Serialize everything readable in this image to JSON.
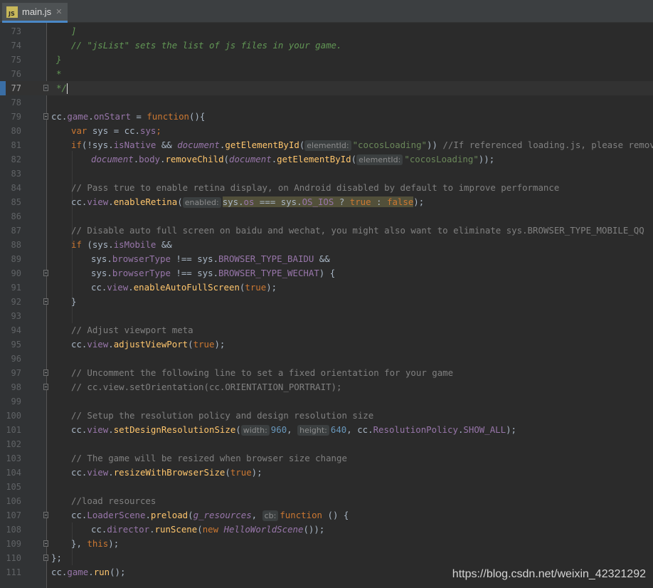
{
  "tab": {
    "label": "main.js",
    "icon": "js-file-icon",
    "badge": "JS"
  },
  "watermark": "https://blog.csdn.net/weixin_42321292",
  "colors": {
    "background": "#2b2b2b",
    "gutter": "#313335",
    "accent": "#4a88c7"
  },
  "current_line": "77",
  "line_numbers": [
    "73",
    "74",
    "75",
    "76",
    "77",
    "78",
    "79",
    "80",
    "81",
    "82",
    "83",
    "84",
    "85",
    "86",
    "87",
    "88",
    "89",
    "90",
    "91",
    "92",
    "93",
    "94",
    "95",
    "96",
    "97",
    "98",
    "99",
    "100",
    "101",
    "102",
    "103",
    "104",
    "105",
    "106",
    "107",
    "108",
    "109",
    "110",
    "111"
  ],
  "code": {
    "l73": "]",
    "l74": "// \"jsList\" sets the list of js files in your game.",
    "l75": "}",
    "l76": "*",
    "l77": "*/",
    "l79_a": "cc",
    "l79_b": ".",
    "l79_c": "game",
    "l79_d": ".",
    "l79_e": "onStart",
    "l79_f": " = ",
    "l79_g": "function",
    "l79_h": "(){",
    "l80_a": "var",
    "l80_b": " sys = ",
    "l80_c": "cc",
    "l80_d": ".",
    "l80_e": "sys",
    "l80_f": ";",
    "l81_a": "if",
    "l81_b": "(!sys.",
    "l81_c": "isNative",
    "l81_d": " && ",
    "l81_e": "document",
    "l81_f": ".",
    "l81_g": "getElementById",
    "l81_h": "(",
    "l81_hint": "elementId:",
    "l81_i": "\"cocosLoading\"",
    "l81_j": ")) ",
    "l81_k": "//If referenced loading.js, please remove it",
    "l82_a": "document",
    "l82_b": ".",
    "l82_c": "body",
    "l82_d": ".",
    "l82_e": "removeChild",
    "l82_f": "(",
    "l82_g": "document",
    "l82_h": ".",
    "l82_i": "getElementById",
    "l82_j": "(",
    "l82_hint": "elementId:",
    "l82_k": "\"cocosLoading\"",
    "l82_l": "));",
    "l84": "// Pass true to enable retina display, on Android disabled by default to improve performance",
    "l85_a": "cc",
    "l85_b": ".",
    "l85_c": "view",
    "l85_d": ".",
    "l85_e": "enableRetina",
    "l85_f": "(",
    "l85_hint": "enabled:",
    "l85_g": "sys.",
    "l85_h": "os",
    "l85_i": " === sys.",
    "l85_j": "OS_IOS",
    "l85_k": " ? ",
    "l85_l": "true",
    "l85_m": " : ",
    "l85_n": "false",
    "l85_o": ");",
    "l87": "// Disable auto full screen on baidu and wechat, you might also want to eliminate sys.BROWSER_TYPE_MOBILE_QQ",
    "l88_a": "if",
    "l88_b": " (sys.",
    "l88_c": "isMobile",
    "l88_d": " &&",
    "l89_a": "sys.",
    "l89_b": "browserType",
    "l89_c": " !== sys.",
    "l89_d": "BROWSER_TYPE_BAIDU",
    "l89_e": " &&",
    "l90_a": "sys.",
    "l90_b": "browserType",
    "l90_c": " !== sys.",
    "l90_d": "BROWSER_TYPE_WECHAT",
    "l90_e": ") {",
    "l91_a": "cc",
    "l91_b": ".",
    "l91_c": "view",
    "l91_d": ".",
    "l91_e": "enableAutoFullScreen",
    "l91_f": "(",
    "l91_g": "true",
    "l91_h": ");",
    "l92": "}",
    "l94": "// Adjust viewport meta",
    "l95_a": "cc",
    "l95_b": ".",
    "l95_c": "view",
    "l95_d": ".",
    "l95_e": "adjustViewPort",
    "l95_f": "(",
    "l95_g": "true",
    "l95_h": ");",
    "l97": "// Uncomment the following line to set a fixed orientation for your game",
    "l98": "// cc.view.setOrientation(cc.ORIENTATION_PORTRAIT);",
    "l100": "// Setup the resolution policy and design resolution size",
    "l101_a": "cc",
    "l101_b": ".",
    "l101_c": "view",
    "l101_d": ".",
    "l101_e": "setDesignResolutionSize",
    "l101_f": "(",
    "l101_hint1": "width:",
    "l101_g": "960",
    "l101_h": ", ",
    "l101_hint2": "height:",
    "l101_i": "640",
    "l101_j": ", ",
    "l101_k": "cc",
    "l101_l": ".",
    "l101_m": "ResolutionPolicy",
    "l101_n": ".",
    "l101_o": "SHOW_ALL",
    "l101_p": ");",
    "l103": "// The game will be resized when browser size change",
    "l104_a": "cc",
    "l104_b": ".",
    "l104_c": "view",
    "l104_d": ".",
    "l104_e": "resizeWithBrowserSize",
    "l104_f": "(",
    "l104_g": "true",
    "l104_h": ");",
    "l106": "//load resources",
    "l107_a": "cc",
    "l107_b": ".",
    "l107_c": "LoaderScene",
    "l107_d": ".",
    "l107_e": "preload",
    "l107_f": "(",
    "l107_g": "g_resources",
    "l107_h": ", ",
    "l107_hint": "cb:",
    "l107_i": "function",
    "l107_j": " () {",
    "l108_a": "cc",
    "l108_b": ".",
    "l108_c": "director",
    "l108_d": ".",
    "l108_e": "runScene",
    "l108_f": "(",
    "l108_g": "new",
    "l108_h": " ",
    "l108_i": "HelloWorldScene",
    "l108_j": "());",
    "l109_a": "}, ",
    "l109_b": "this",
    "l109_c": ");",
    "l110": "};",
    "l111_a": "cc",
    "l111_b": ".",
    "l111_c": "game",
    "l111_d": ".",
    "l111_e": "run",
    "l111_f": "();"
  }
}
